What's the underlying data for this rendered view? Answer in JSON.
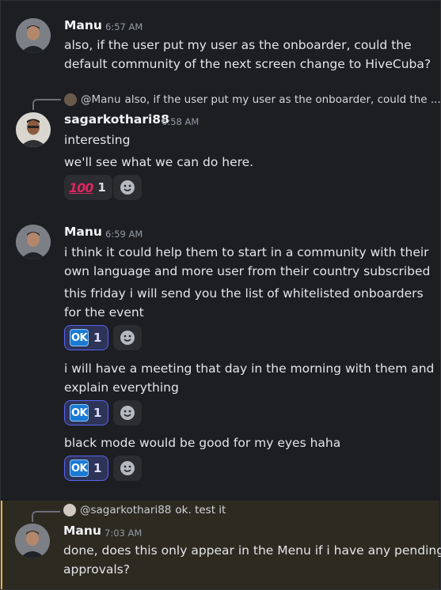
{
  "colors": {
    "background": "#1d1e22",
    "mention_highlight": "#2d2a21",
    "mention_bar": "#f0b232",
    "reaction_active_border": "#5865f2"
  },
  "messages": [
    {
      "author": "Manu",
      "time": "6:57 AM",
      "lines": [
        "also, if the user put my user as the onboarder, could the",
        "default community of the next screen change to HiveCuba?"
      ]
    },
    {
      "reply_to": {
        "name": "@Manu",
        "text": "also, if the user put my user as the onboarder, could the ..."
      },
      "author": "sagarkothari88",
      "time": "6:58 AM",
      "lines": [
        "interesting"
      ],
      "followup": "we'll see what we can do here.",
      "reaction": {
        "emoji": "hundred-points",
        "count": "1"
      }
    },
    {
      "author": "Manu",
      "time": "6:59 AM",
      "lines": [
        "i think it could help them to start in a community with their",
        "own language and more user from their country subscribed"
      ],
      "followup1": [
        "this friday i will send you the list of whitelisted onboarders",
        "for the event"
      ],
      "reaction1": {
        "emoji": "ok-button",
        "count": "1"
      },
      "followup2": [
        "i will have a meeting that day in the morning with them and",
        "explain everything"
      ],
      "reaction2": {
        "emoji": "ok-button",
        "count": "1"
      },
      "followup3": "black mode would be good for my eyes haha",
      "reaction3": {
        "emoji": "ok-button",
        "count": "1"
      }
    },
    {
      "reply_to": {
        "name": "@sagarkothari88",
        "text": "ok. test it"
      },
      "author": "Manu",
      "time": "7:03 AM",
      "lines": [
        "done, does this only appear in the Menu if i have any pending",
        "approvals?"
      ]
    }
  ],
  "ok_label": "OK",
  "hundred_label": "100"
}
